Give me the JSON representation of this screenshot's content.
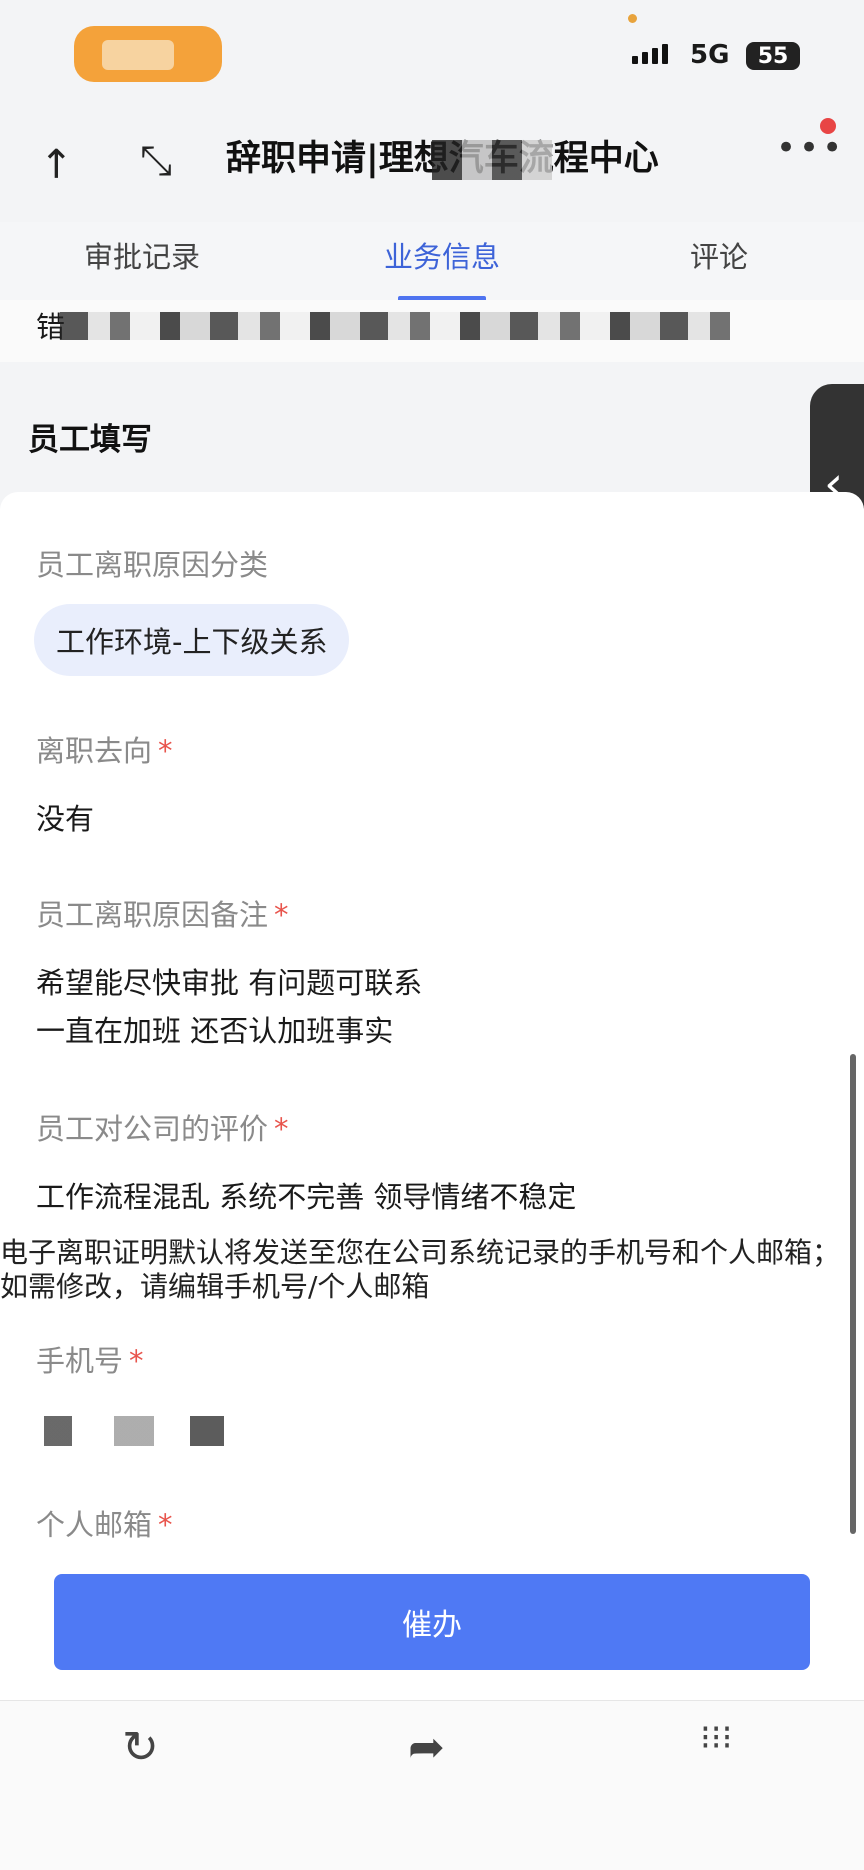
{
  "status_bar": {
    "network": "5G",
    "battery": "55"
  },
  "header": {
    "title": "辞职申请|理想汽车流程中心",
    "more_icon": "more-dots-icon"
  },
  "tabs": [
    {
      "label": "审批记录",
      "active": false
    },
    {
      "label": "业务信息",
      "active": true
    },
    {
      "label": "评论",
      "active": false
    }
  ],
  "top_partial_label": "错",
  "section": {
    "title": "员工填写"
  },
  "form": {
    "reason_category": {
      "label": "员工离职原因分类",
      "value": "工作环境-上下级关系"
    },
    "destination": {
      "label": "离职去向",
      "value": "没有"
    },
    "reason_note": {
      "label": "员工离职原因备注",
      "lines": [
        "希望能尽快审批 有问题可联系",
        "一直在加班 还否认加班事实"
      ]
    },
    "company_review": {
      "label": "员工对公司的评价",
      "value": "工作流程混乱 系统不完善 领导情绪不稳定"
    },
    "notice": "电子离职证明默认将发送至您在公司系统记录的手机号和个人邮箱；如需修改，请编辑手机号/个人邮箱",
    "phone": {
      "label": "手机号"
    },
    "email": {
      "label": "个人邮箱"
    },
    "required_mark": "*"
  },
  "action": {
    "urge_label": "催办"
  },
  "toolbar": {
    "icons": [
      "refresh-icon",
      "share-icon",
      "grid-menu-icon"
    ]
  },
  "colors": {
    "accent": "#4f79f4",
    "tab_active": "#3d63d8",
    "required": "#e8544c",
    "chip_bg": "#e9eefc"
  }
}
